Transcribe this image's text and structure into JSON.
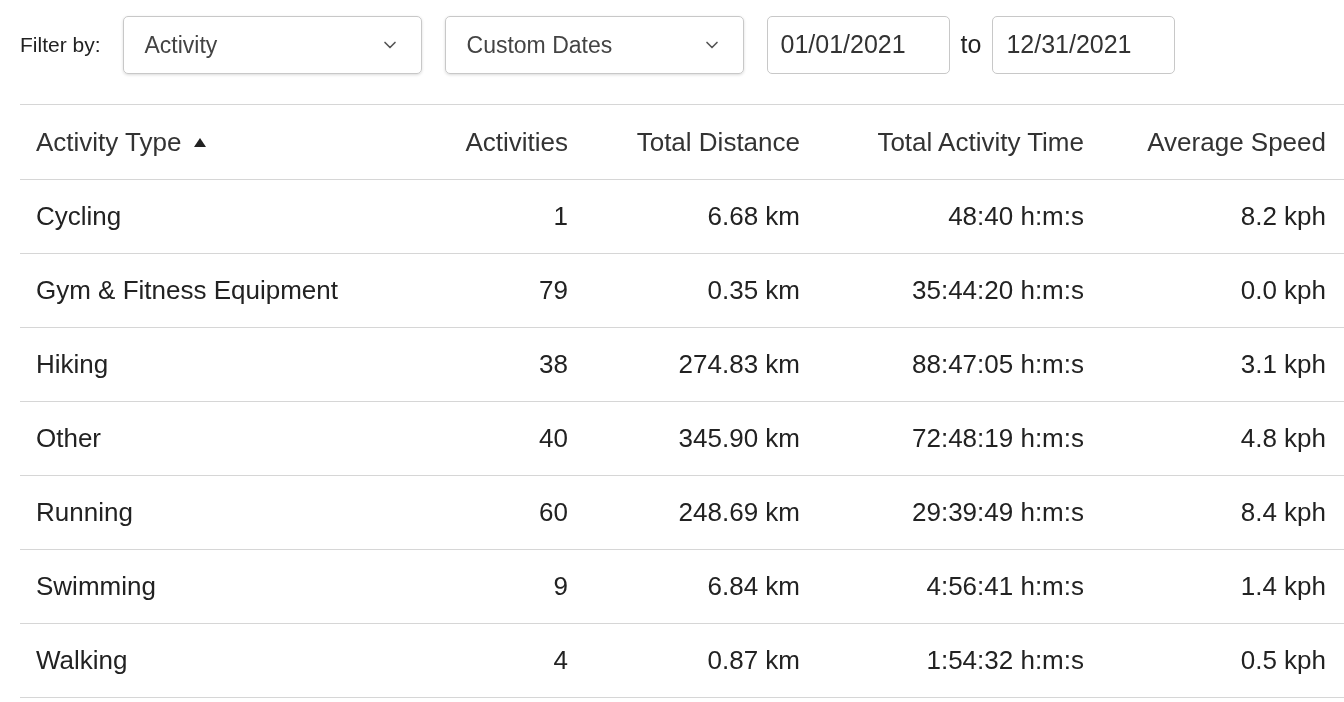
{
  "filter": {
    "label": "Filter by:",
    "selects": [
      {
        "value": "Activity"
      },
      {
        "value": "Custom Dates"
      }
    ],
    "date_from": "01/01/2021",
    "separator": "to",
    "date_to": "12/31/2021"
  },
  "table": {
    "columns": [
      {
        "label": "Activity Type",
        "sorted": true,
        "numeric": false
      },
      {
        "label": "Activities",
        "sorted": false,
        "numeric": true
      },
      {
        "label": "Total Distance",
        "sorted": false,
        "numeric": true
      },
      {
        "label": "Total Activity Time",
        "sorted": false,
        "numeric": true
      },
      {
        "label": "Average Speed",
        "sorted": false,
        "numeric": true
      }
    ],
    "rows": [
      [
        "Cycling",
        "1",
        "6.68 km",
        "48:40 h:m:s",
        "8.2 kph"
      ],
      [
        "Gym & Fitness Equipment",
        "79",
        "0.35 km",
        "35:44:20 h:m:s",
        "0.0 kph"
      ],
      [
        "Hiking",
        "38",
        "274.83 km",
        "88:47:05 h:m:s",
        "3.1 kph"
      ],
      [
        "Other",
        "40",
        "345.90 km",
        "72:48:19 h:m:s",
        "4.8 kph"
      ],
      [
        "Running",
        "60",
        "248.69 km",
        "29:39:49 h:m:s",
        "8.4 kph"
      ],
      [
        "Swimming",
        "9",
        "6.84 km",
        "4:56:41 h:m:s",
        "1.4 kph"
      ],
      [
        "Walking",
        "4",
        "0.87 km",
        "1:54:32 h:m:s",
        "0.5 kph"
      ]
    ]
  }
}
